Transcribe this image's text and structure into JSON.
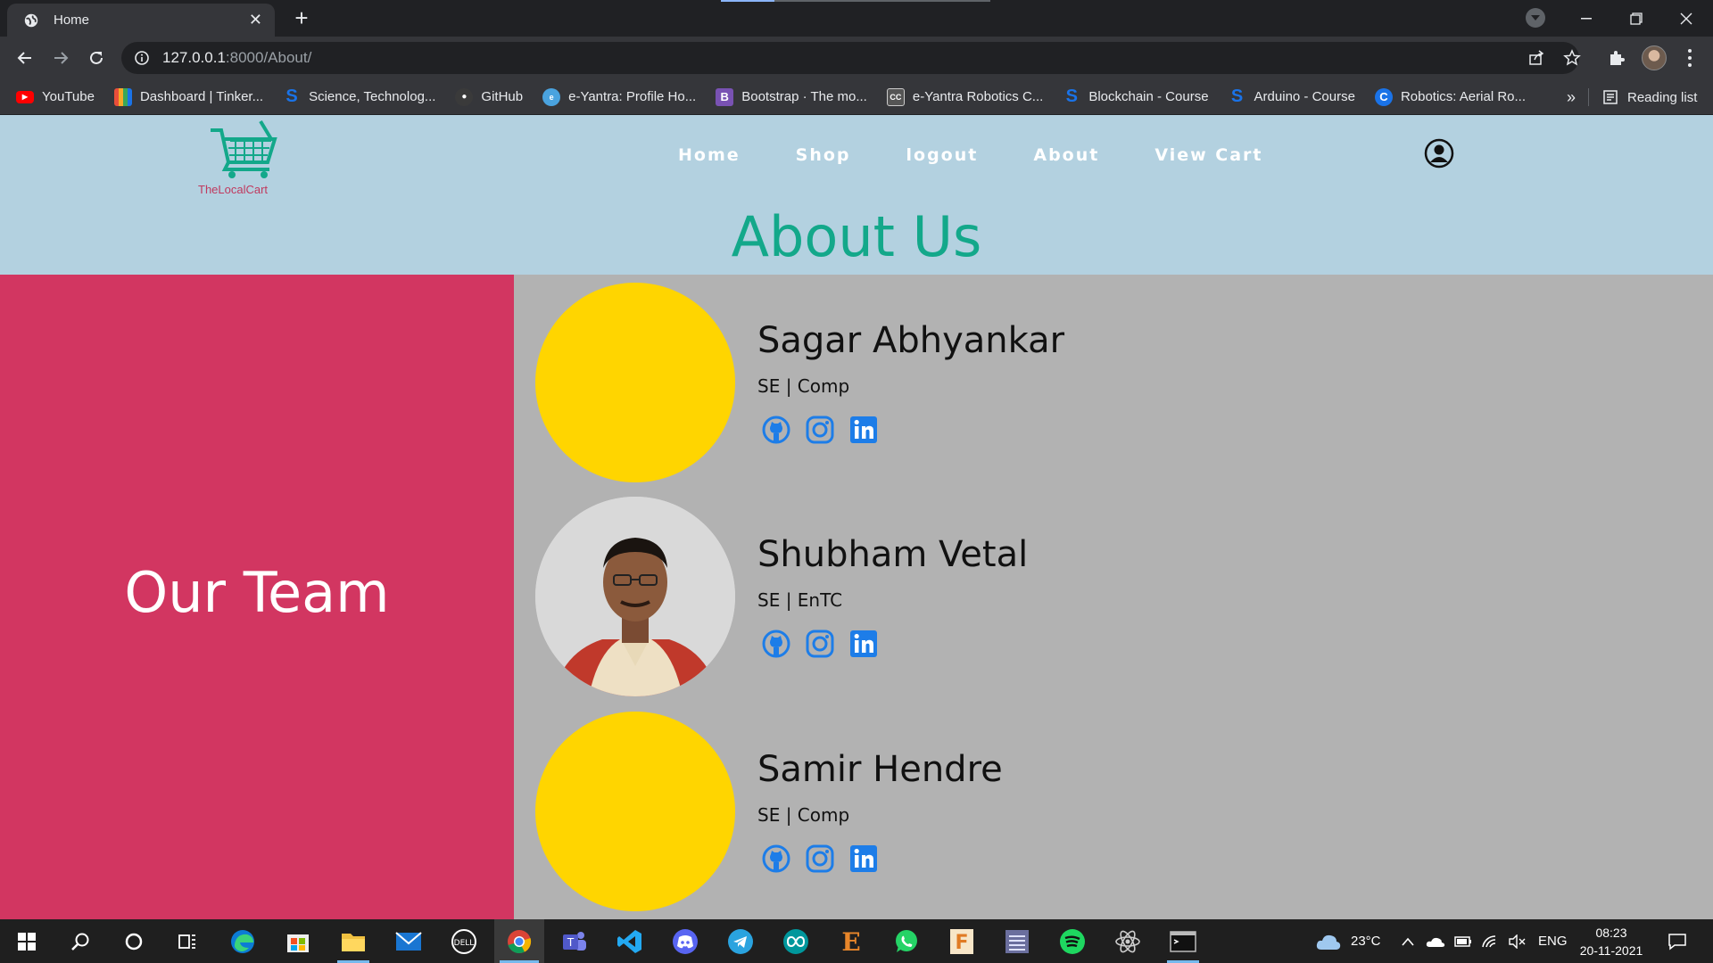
{
  "browser": {
    "tab_title": "Home",
    "url_host": "127.0.0.1",
    "url_path": ":8000/About/",
    "bookmarks": [
      {
        "label": "YouTube",
        "icon": "youtube-icon",
        "color": "#ff0000"
      },
      {
        "label": "Dashboard | Tinker...",
        "icon": "tinkercad-icon",
        "color": "#e94e3a"
      },
      {
        "label": "Science, Technolog...",
        "icon": "s-logo-icon",
        "color": "#1a73e8"
      },
      {
        "label": "GitHub",
        "icon": "github-icon",
        "color": "#3a3a3a"
      },
      {
        "label": "e-Yantra: Profile Ho...",
        "icon": "eyantra-icon",
        "color": "#4aa3df"
      },
      {
        "label": "Bootstrap · The mo...",
        "icon": "bootstrap-icon",
        "color": "#7952b3"
      },
      {
        "label": "e-Yantra Robotics C...",
        "icon": "cc-icon",
        "color": "#555555"
      },
      {
        "label": "Blockchain - Course",
        "icon": "s-logo-icon",
        "color": "#1a73e8"
      },
      {
        "label": "Arduino - Course",
        "icon": "s-logo-icon",
        "color": "#1a73e8"
      },
      {
        "label": "Robotics: Aerial Ro...",
        "icon": "coursera-icon",
        "color": "#1a73e8"
      }
    ],
    "bookmarks_more": "»",
    "reading_list": "Reading list"
  },
  "site": {
    "logo_text": "TheLocalCart",
    "nav": [
      "Home",
      "Shop",
      "logout",
      "About",
      "View Cart"
    ],
    "page_title": "About Us",
    "team_title": "Our Team",
    "members": [
      {
        "name": "Sagar Abhyankar",
        "role": "SE | Comp",
        "has_photo": false
      },
      {
        "name": "Shubham Vetal",
        "role": "SE | EnTC",
        "has_photo": true
      },
      {
        "name": "Samir Hendre",
        "role": "SE | Comp",
        "has_photo": false
      }
    ],
    "colors": {
      "header_bg": "#b3d1e0",
      "accent_green": "#13a88a",
      "team_panel": "#d23661",
      "content_bg": "#b2b2b2",
      "placeholder_avatar": "#ffd500",
      "social_blue": "#1d7de8"
    }
  },
  "taskbar": {
    "weather": "23°C",
    "language": "ENG",
    "time": "08:23",
    "date": "20-11-2021"
  }
}
